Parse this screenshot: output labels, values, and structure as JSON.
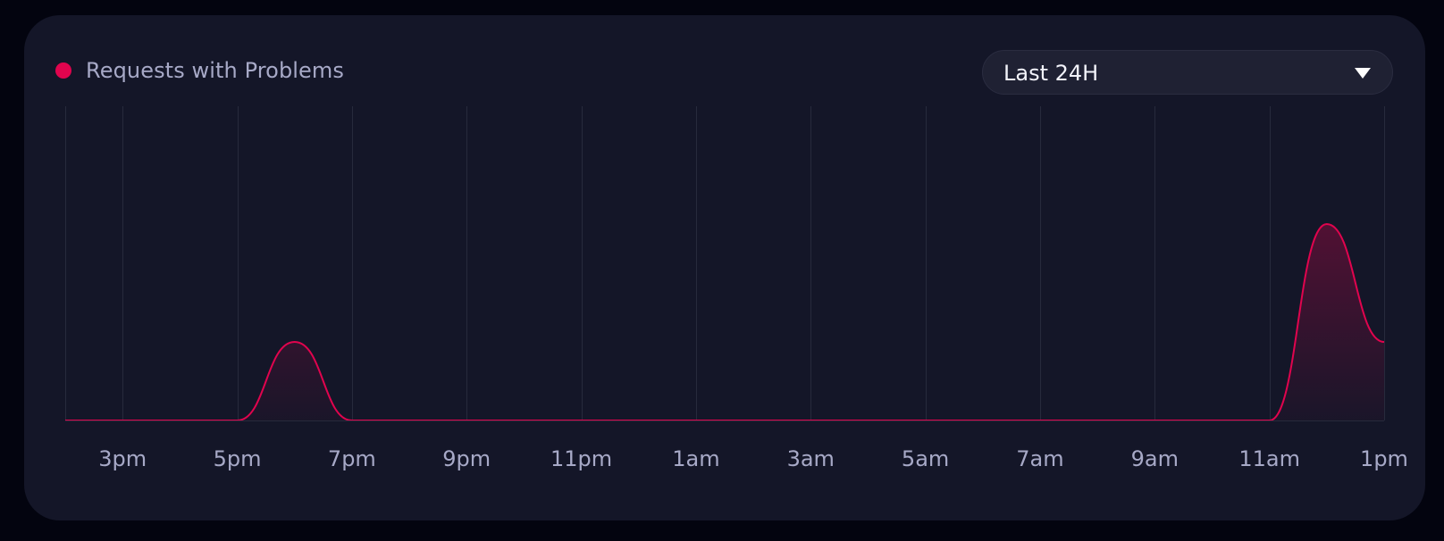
{
  "legend": {
    "label": "Requests with Problems",
    "color": "#e0044e"
  },
  "time_range": {
    "selected": "Last 24H"
  },
  "colors": {
    "line": "#e0044e",
    "grid": "#272a3c",
    "tick_text": "#a7a9c7",
    "card_background": "#141628"
  },
  "chart_data": {
    "type": "area",
    "title": "",
    "xlabel": "",
    "ylabel": "",
    "x_tick_labels": [
      "3pm",
      "5pm",
      "7pm",
      "9pm",
      "11pm",
      "1am",
      "3am",
      "5am",
      "7am",
      "9am",
      "11am",
      "1pm"
    ],
    "x_range_hours": [
      14,
      37
    ],
    "y_axis_labels_visible": false,
    "grid": "vertical",
    "series": [
      {
        "name": "Requests with Problems",
        "color": "#e0044e",
        "points": [
          {
            "x_hour": 14,
            "y": 0
          },
          {
            "x_hour": 17,
            "y": 0
          },
          {
            "x_hour": 18,
            "y": 0.4
          },
          {
            "x_hour": 19,
            "y": 0
          },
          {
            "x_hour": 35,
            "y": 0
          },
          {
            "x_hour": 36,
            "y": 1
          },
          {
            "x_hour": 37,
            "y": 0.4
          }
        ]
      }
    ]
  }
}
